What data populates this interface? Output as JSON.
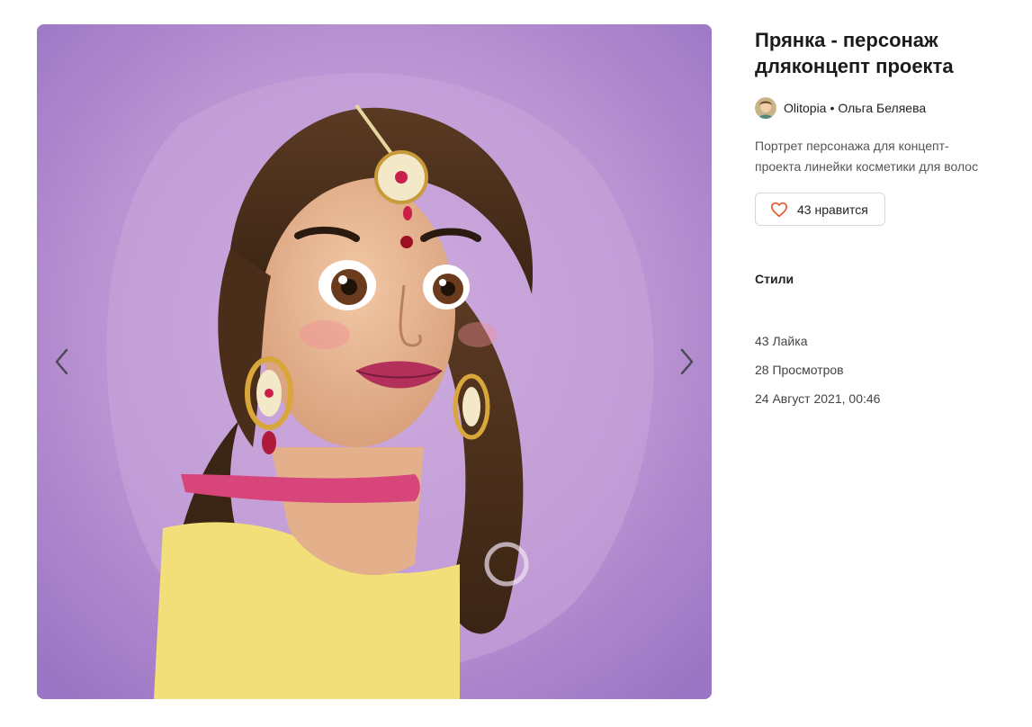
{
  "artwork": {
    "title": "Прянка - персонаж дляконцепт проекта",
    "author": {
      "username": "Olitopia",
      "separator": "•",
      "full_name": "Ольга Беляева",
      "avatar_icon": "avatar-portrait"
    },
    "description": "Портрет персонажа для концепт-проекта линейки косметики для волос",
    "like_button": {
      "icon": "heart-outline-icon",
      "label": "43 нравится",
      "icon_color": "#e8562a"
    },
    "styles_label": "Стили",
    "stats": {
      "likes": "43 Лайка",
      "views": "28 Просмотров",
      "date": "24 Август 2021, 00:46"
    }
  },
  "viewer": {
    "prev_icon": "chevron-left-icon",
    "next_icon": "chevron-right-icon",
    "background_color": "#b58fd0"
  }
}
